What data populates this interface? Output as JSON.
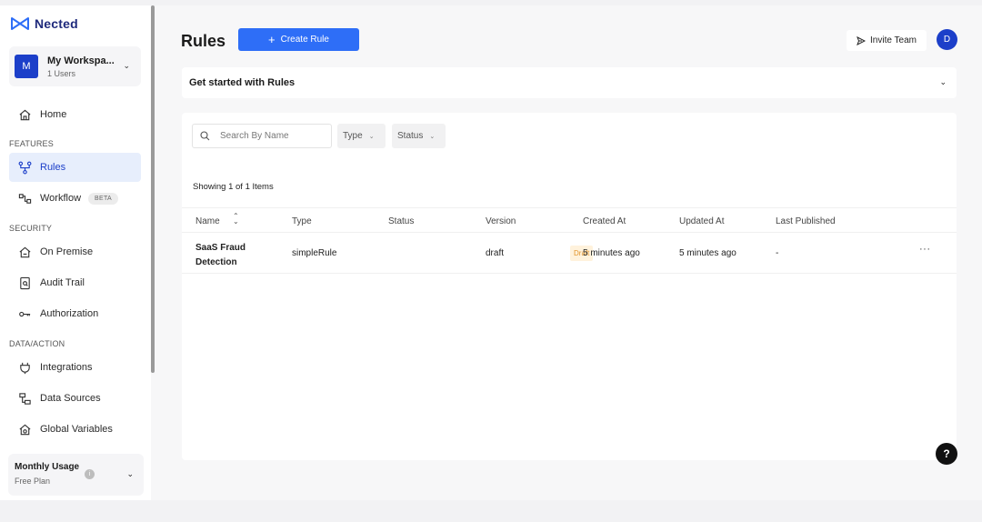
{
  "sidebar": {
    "brand": "Nected",
    "workspace": {
      "initial": "M",
      "name": "My Workspa...",
      "users": "1 Users"
    },
    "home": "Home",
    "sections": {
      "features": "FEATURES",
      "security": "SECURITY",
      "data_action": "DATA/ACTION"
    },
    "items": {
      "rules": "Rules",
      "workflow": "Workflow",
      "workflow_badge": "BETA",
      "on_premise": "On Premise",
      "audit_trail": "Audit Trail",
      "authorization": "Authorization",
      "integrations": "Integrations",
      "data_sources": "Data Sources",
      "global_variables": "Global Variables"
    },
    "usage": {
      "title": "Monthly Usage",
      "plan": "Free Plan"
    }
  },
  "header": {
    "title": "Rules",
    "create_label": "Create Rule",
    "invite_label": "Invite Team",
    "user_initial": "D"
  },
  "get_started": {
    "title": "Get started with Rules"
  },
  "filters": {
    "search_placeholder": "Search By Name",
    "type_label": "Type",
    "status_label": "Status"
  },
  "showing_text": "Showing 1 of 1 Items",
  "table": {
    "columns": [
      "Name",
      "Type",
      "Status",
      "Version",
      "Created At",
      "Updated At",
      "Last Published"
    ],
    "rows": [
      {
        "name_line1": "SaaS Fraud",
        "name_line2": "Detection",
        "type": "simpleRule",
        "status": "Draft",
        "version": "draft",
        "created_at": "5 minutes ago",
        "updated_at": "5 minutes ago",
        "last_published": "-"
      }
    ]
  },
  "colors": {
    "primary": "#2e6ef7",
    "brand_dark": "#1c3fc9",
    "draft_bg": "#fff2dc",
    "draft_text": "#e2942b"
  }
}
